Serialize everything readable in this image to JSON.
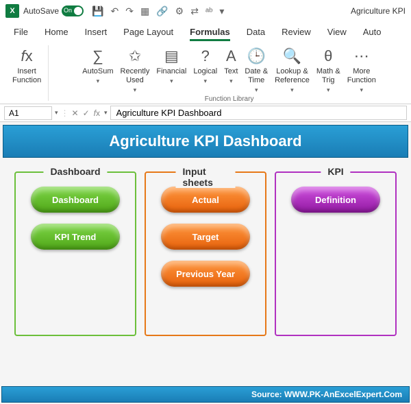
{
  "titlebar": {
    "autosave_label": "AutoSave",
    "toggle_state": "On",
    "doc_title": "Agriculture KPI"
  },
  "tabs": [
    "File",
    "Home",
    "Insert",
    "Page Layout",
    "Formulas",
    "Data",
    "Review",
    "View",
    "Auto"
  ],
  "active_tab": "Formulas",
  "ribbon": {
    "insert_function": "Insert\nFunction",
    "buttons": [
      "AutoSum",
      "Recently\nUsed",
      "Financial",
      "Logical",
      "Text",
      "Date &\nTime",
      "Lookup &\nReference",
      "Math &\nTrig",
      "More\nFunction"
    ],
    "group_label": "Function Library"
  },
  "formula_bar": {
    "cell": "A1",
    "value": "Agriculture KPI Dashboard"
  },
  "dashboard": {
    "title": "Agriculture KPI Dashboard",
    "cards": [
      {
        "title": "Dashboard",
        "color": "green",
        "buttons": [
          "Dashboard",
          "KPI Trend"
        ]
      },
      {
        "title": "Input sheets",
        "color": "orange",
        "buttons": [
          "Actual",
          "Target",
          "Previous Year"
        ]
      },
      {
        "title": "KPI",
        "color": "purple",
        "buttons": [
          "Definition"
        ]
      }
    ],
    "source": "Source: WWW.PK-AnExcelExpert.Com"
  }
}
